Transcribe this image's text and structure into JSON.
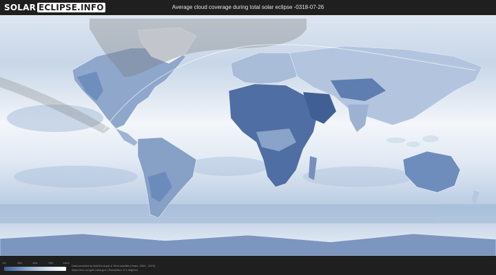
{
  "header": {
    "logo_part1": "SOLAR",
    "logo_part2": "ECLIPSE.INFO",
    "title": "Average cloud coverage during total solar eclipse -0318-07-26"
  },
  "legend": {
    "scale_ticks": [
      "0%",
      "25%",
      "50%",
      "75%",
      "100%"
    ],
    "scale_colors": [
      "#3e5f93",
      "#6f8fbc",
      "#a9c0dc",
      "#d9e5f1",
      "#ffffff"
    ]
  },
  "footer": {
    "credit_line1": "Data provided by NASA's Aqua & Terra satellite (Years: 2000 - 2019)",
    "credit_line2": "https://neo.sci.gsfc.nasa.gov | Resolution: 0.1 degrees"
  },
  "colors": {
    "background": "#1f1f1f",
    "ocean_low_cloud": "#eef3f8",
    "land_clear": "#3e5f93",
    "eclipse_path": "#7a7a7a"
  }
}
